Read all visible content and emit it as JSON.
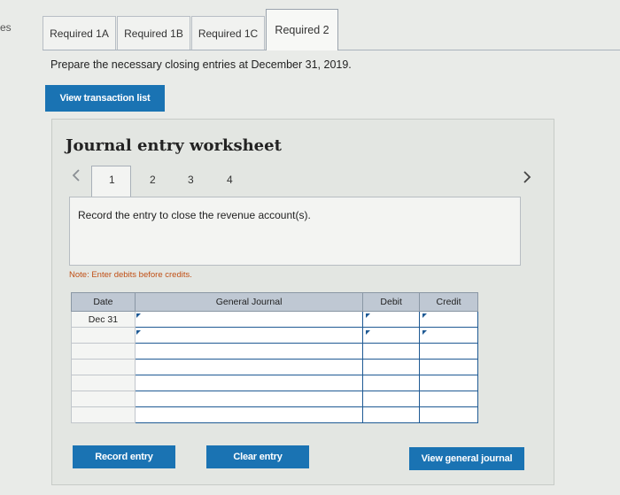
{
  "edge_text": "es",
  "tabs": [
    {
      "label": "Required 1A",
      "active": false
    },
    {
      "label": "Required 1B",
      "active": false
    },
    {
      "label": "Required 1C",
      "active": false
    },
    {
      "label": "Required 2",
      "active": true
    }
  ],
  "instruction": "Prepare the necessary closing entries at December 31, 2019.",
  "view_transaction_label": "View transaction list",
  "worksheet": {
    "title": "Journal entry worksheet",
    "pages": [
      "1",
      "2",
      "3",
      "4"
    ],
    "current_page": "1",
    "prev_icon": "chevron-left-icon",
    "next_icon": "chevron-right-icon",
    "record_text": "Record the entry to close the revenue account(s).",
    "note": "Note: Enter debits before credits."
  },
  "journal": {
    "headers": {
      "date": "Date",
      "general_journal": "General Journal",
      "debit": "Debit",
      "credit": "Credit"
    },
    "rows": [
      {
        "date": "Dec 31"
      },
      {
        "date": ""
      },
      {
        "date": ""
      },
      {
        "date": ""
      },
      {
        "date": ""
      },
      {
        "date": ""
      },
      {
        "date": ""
      }
    ]
  },
  "buttons": {
    "record_entry": "Record entry",
    "clear_entry": "Clear entry",
    "view_general_journal": "View general journal"
  },
  "colors": {
    "button_blue": "#1a73b3",
    "note_orange": "#c04f15",
    "header_gray": "#bfc8d3"
  }
}
